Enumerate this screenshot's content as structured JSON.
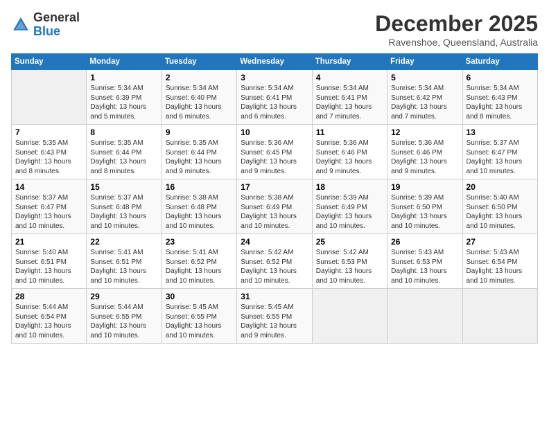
{
  "header": {
    "logo_general": "General",
    "logo_blue": "Blue",
    "month": "December 2025",
    "location": "Ravenshoe, Queensland, Australia"
  },
  "weekdays": [
    "Sunday",
    "Monday",
    "Tuesday",
    "Wednesday",
    "Thursday",
    "Friday",
    "Saturday"
  ],
  "weeks": [
    [
      {
        "day": "",
        "info": ""
      },
      {
        "day": "1",
        "info": "Sunrise: 5:34 AM\nSunset: 6:39 PM\nDaylight: 13 hours\nand 5 minutes."
      },
      {
        "day": "2",
        "info": "Sunrise: 5:34 AM\nSunset: 6:40 PM\nDaylight: 13 hours\nand 6 minutes."
      },
      {
        "day": "3",
        "info": "Sunrise: 5:34 AM\nSunset: 6:41 PM\nDaylight: 13 hours\nand 6 minutes."
      },
      {
        "day": "4",
        "info": "Sunrise: 5:34 AM\nSunset: 6:41 PM\nDaylight: 13 hours\nand 7 minutes."
      },
      {
        "day": "5",
        "info": "Sunrise: 5:34 AM\nSunset: 6:42 PM\nDaylight: 13 hours\nand 7 minutes."
      },
      {
        "day": "6",
        "info": "Sunrise: 5:34 AM\nSunset: 6:43 PM\nDaylight: 13 hours\nand 8 minutes."
      }
    ],
    [
      {
        "day": "7",
        "info": "Sunrise: 5:35 AM\nSunset: 6:43 PM\nDaylight: 13 hours\nand 8 minutes."
      },
      {
        "day": "8",
        "info": "Sunrise: 5:35 AM\nSunset: 6:44 PM\nDaylight: 13 hours\nand 8 minutes."
      },
      {
        "day": "9",
        "info": "Sunrise: 5:35 AM\nSunset: 6:44 PM\nDaylight: 13 hours\nand 9 minutes."
      },
      {
        "day": "10",
        "info": "Sunrise: 5:36 AM\nSunset: 6:45 PM\nDaylight: 13 hours\nand 9 minutes."
      },
      {
        "day": "11",
        "info": "Sunrise: 5:36 AM\nSunset: 6:46 PM\nDaylight: 13 hours\nand 9 minutes."
      },
      {
        "day": "12",
        "info": "Sunrise: 5:36 AM\nSunset: 6:46 PM\nDaylight: 13 hours\nand 9 minutes."
      },
      {
        "day": "13",
        "info": "Sunrise: 5:37 AM\nSunset: 6:47 PM\nDaylight: 13 hours\nand 10 minutes."
      }
    ],
    [
      {
        "day": "14",
        "info": "Sunrise: 5:37 AM\nSunset: 6:47 PM\nDaylight: 13 hours\nand 10 minutes."
      },
      {
        "day": "15",
        "info": "Sunrise: 5:37 AM\nSunset: 6:48 PM\nDaylight: 13 hours\nand 10 minutes."
      },
      {
        "day": "16",
        "info": "Sunrise: 5:38 AM\nSunset: 6:48 PM\nDaylight: 13 hours\nand 10 minutes."
      },
      {
        "day": "17",
        "info": "Sunrise: 5:38 AM\nSunset: 6:49 PM\nDaylight: 13 hours\nand 10 minutes."
      },
      {
        "day": "18",
        "info": "Sunrise: 5:39 AM\nSunset: 6:49 PM\nDaylight: 13 hours\nand 10 minutes."
      },
      {
        "day": "19",
        "info": "Sunrise: 5:39 AM\nSunset: 6:50 PM\nDaylight: 13 hours\nand 10 minutes."
      },
      {
        "day": "20",
        "info": "Sunrise: 5:40 AM\nSunset: 6:50 PM\nDaylight: 13 hours\nand 10 minutes."
      }
    ],
    [
      {
        "day": "21",
        "info": "Sunrise: 5:40 AM\nSunset: 6:51 PM\nDaylight: 13 hours\nand 10 minutes."
      },
      {
        "day": "22",
        "info": "Sunrise: 5:41 AM\nSunset: 6:51 PM\nDaylight: 13 hours\nand 10 minutes."
      },
      {
        "day": "23",
        "info": "Sunrise: 5:41 AM\nSunset: 6:52 PM\nDaylight: 13 hours\nand 10 minutes."
      },
      {
        "day": "24",
        "info": "Sunrise: 5:42 AM\nSunset: 6:52 PM\nDaylight: 13 hours\nand 10 minutes."
      },
      {
        "day": "25",
        "info": "Sunrise: 5:42 AM\nSunset: 6:53 PM\nDaylight: 13 hours\nand 10 minutes."
      },
      {
        "day": "26",
        "info": "Sunrise: 5:43 AM\nSunset: 6:53 PM\nDaylight: 13 hours\nand 10 minutes."
      },
      {
        "day": "27",
        "info": "Sunrise: 5:43 AM\nSunset: 6:54 PM\nDaylight: 13 hours\nand 10 minutes."
      }
    ],
    [
      {
        "day": "28",
        "info": "Sunrise: 5:44 AM\nSunset: 6:54 PM\nDaylight: 13 hours\nand 10 minutes."
      },
      {
        "day": "29",
        "info": "Sunrise: 5:44 AM\nSunset: 6:55 PM\nDaylight: 13 hours\nand 10 minutes."
      },
      {
        "day": "30",
        "info": "Sunrise: 5:45 AM\nSunset: 6:55 PM\nDaylight: 13 hours\nand 10 minutes."
      },
      {
        "day": "31",
        "info": "Sunrise: 5:45 AM\nSunset: 6:55 PM\nDaylight: 13 hours\nand 9 minutes."
      },
      {
        "day": "",
        "info": ""
      },
      {
        "day": "",
        "info": ""
      },
      {
        "day": "",
        "info": ""
      }
    ]
  ]
}
